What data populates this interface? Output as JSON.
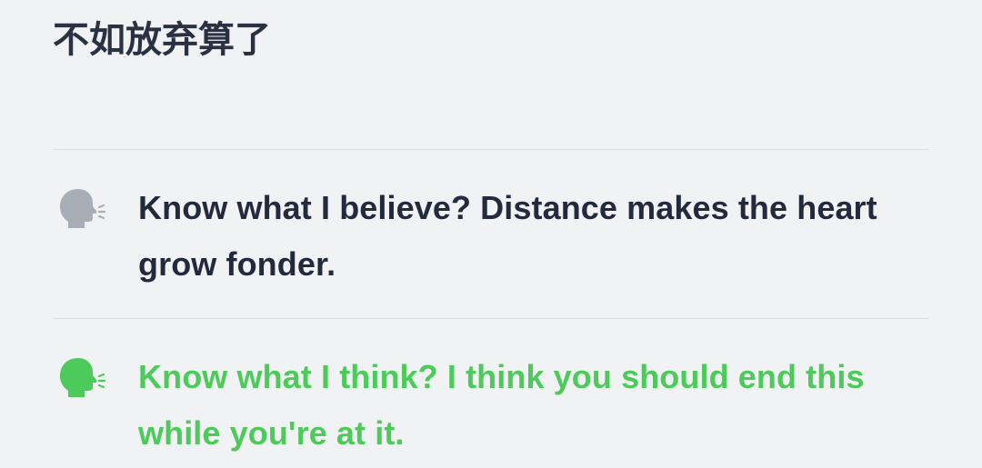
{
  "header": {
    "title": "不如放弃算了"
  },
  "lines": [
    {
      "icon": "speaking-head-icon",
      "color": "#a9aeb6",
      "text": "Know what I believe? Distance makes the heart grow fonder."
    },
    {
      "icon": "speaking-head-icon",
      "color": "#4cca5a",
      "text": "Know what I think? I think you should end this while you're at it."
    }
  ]
}
